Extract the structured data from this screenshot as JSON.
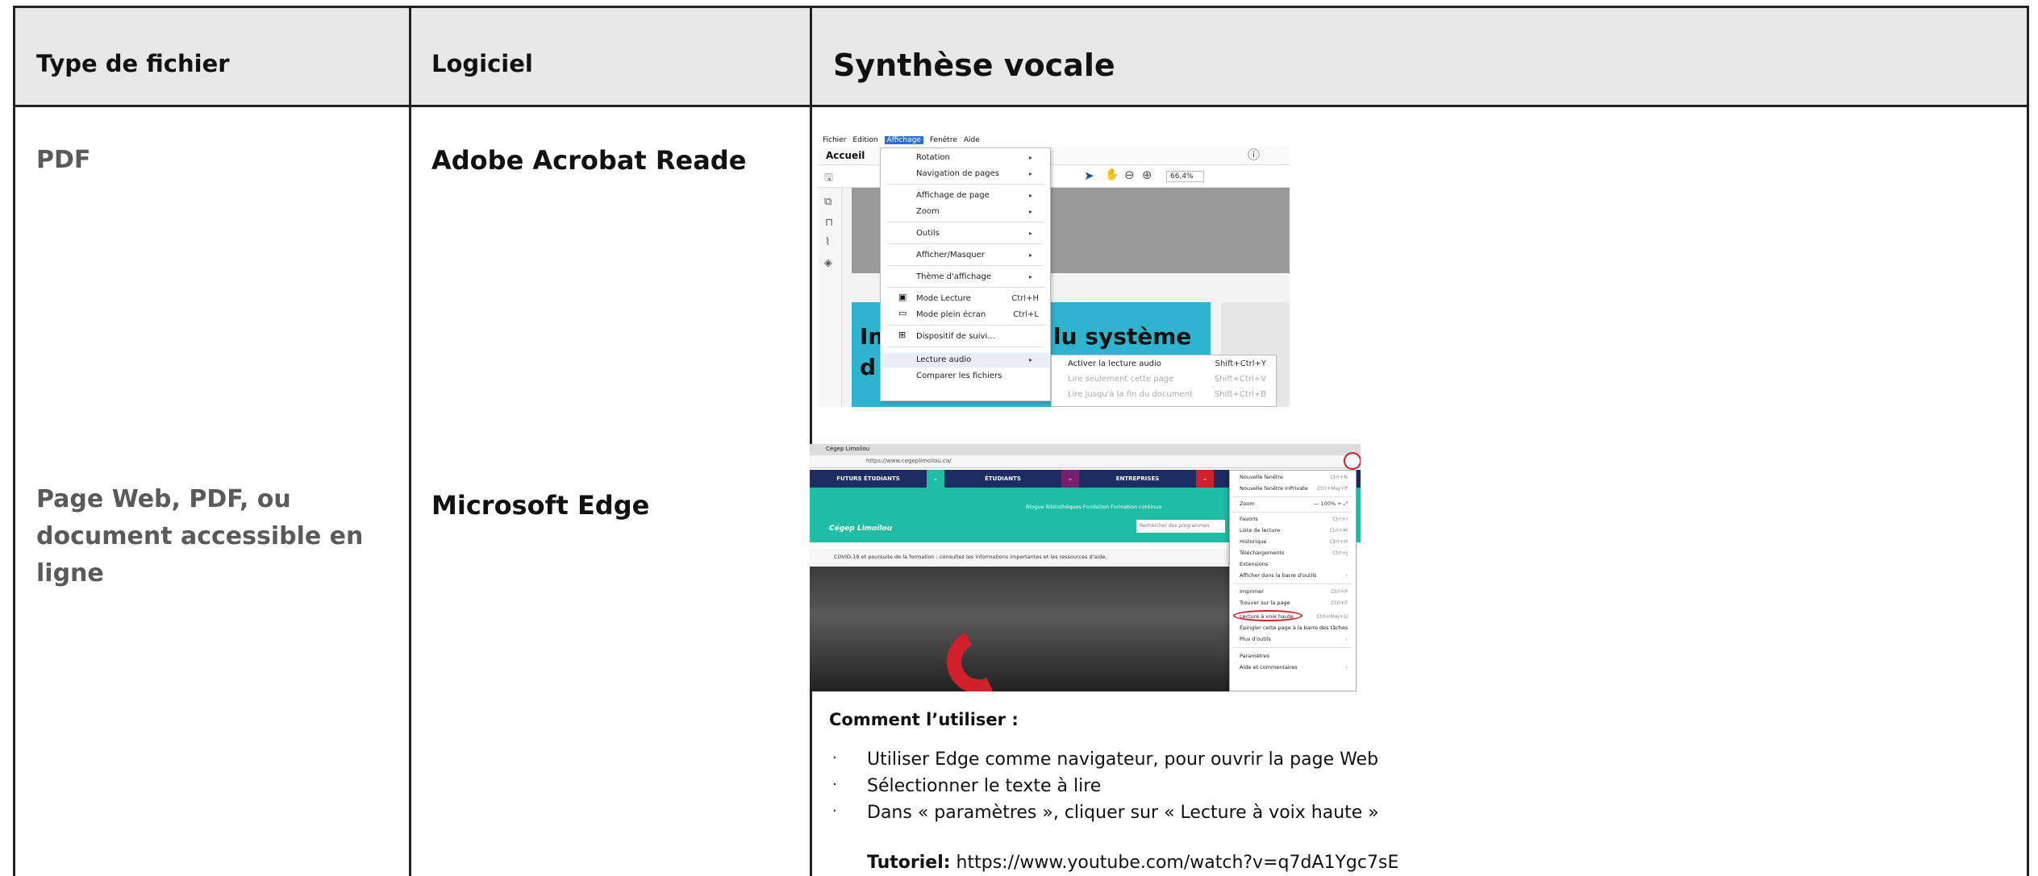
{
  "table": {
    "headers": {
      "type": "Type de fichier",
      "software": "Logiciel",
      "tts": "Synthèse vocale"
    },
    "rows": [
      {
        "type": "PDF",
        "software": "Adobe Acrobat Reade"
      },
      {
        "type_lines": [
          "Page Web, PDF, ou",
          "document accessible en",
          "ligne"
        ],
        "software": "Microsoft Edge"
      }
    ]
  },
  "acrobat_screenshot": {
    "menubar": [
      "Fichier",
      "Edition",
      "Affichage",
      "Fenêtre",
      "Aide"
    ],
    "tab": "Accueil",
    "zoom": "66,4%",
    "menu_items": [
      {
        "label": "Rotation",
        "submenu": true
      },
      {
        "label": "Navigation de pages",
        "submenu": true
      },
      {
        "label": "Affichage de page",
        "submenu": true
      },
      {
        "label": "Zoom",
        "submenu": true
      },
      {
        "label": "Outils",
        "submenu": true
      },
      {
        "label": "Afficher/Masquer",
        "submenu": true
      },
      {
        "label": "Thème d'affichage",
        "submenu": true
      },
      {
        "label": "Mode Lecture",
        "shortcut": "Ctrl+H"
      },
      {
        "label": "Mode plein écran",
        "shortcut": "Ctrl+L"
      },
      {
        "label": "Dispositif de suivi..."
      },
      {
        "label": "Lecture audio",
        "submenu": true,
        "highlighted": true
      },
      {
        "label": "Comparer les fichiers"
      }
    ],
    "submenu_items": [
      {
        "label": "Activer la lecture audio",
        "shortcut": "Shift+Ctrl+Y"
      },
      {
        "label": "Lire seulement cette page",
        "shortcut": "Shift+Ctrl+V"
      },
      {
        "label": "Lire jusqu'à la fin du document",
        "shortcut": "Shift+Ctrl+B"
      }
    ],
    "doc_text_left_1": "Im",
    "doc_text_left_2": "d",
    "doc_text_right": "lu système"
  },
  "edge_screenshot": {
    "tab_title": "Cégep Limoilou",
    "url": "https://www.cegeplimoilou.ca/",
    "nav": [
      "FUTURS ÉTUDIANTS",
      "ÉTUDIANTS",
      "ENTREPRISES"
    ],
    "logo": "Cégep Limoilou",
    "links": "Blogue   Bibliothèques   Fondation   Formation continue",
    "search_placeholder": "Rechercher des programmes",
    "notice": "COVID-19 et poursuite de la formation : consultez les informations importantes et les ressources d'aide.",
    "menu": [
      {
        "label": "Nouvelle fenêtre",
        "shortcut": "Ctrl+N"
      },
      {
        "label": "Nouvelle fenêtre InPrivate",
        "shortcut": "Ctrl+Maj+P"
      },
      {
        "label": "Zoom",
        "shortcut": "—  100%  +  ⤢"
      },
      {
        "label": "Favoris",
        "shortcut": "Ctrl+I"
      },
      {
        "label": "Liste de lecture",
        "shortcut": "Ctrl+M"
      },
      {
        "label": "Historique",
        "shortcut": "Ctrl+H"
      },
      {
        "label": "Téléchargements",
        "shortcut": "Ctrl+J"
      },
      {
        "label": "Extensions",
        "shortcut": ""
      },
      {
        "label": "Afficher dans la barre d'outils",
        "shortcut": "›"
      },
      {
        "label": "Imprimer",
        "shortcut": "Ctrl+P"
      },
      {
        "label": "Trouver sur la page",
        "shortcut": "Ctrl+F"
      },
      {
        "label": "Lecture à voix haute",
        "shortcut": "Ctrl+Maj+U"
      },
      {
        "label": "Épingler cette page à la barre des tâches",
        "shortcut": ""
      },
      {
        "label": "Plus d'outils",
        "shortcut": "›"
      },
      {
        "label": "Paramètres",
        "shortcut": ""
      },
      {
        "label": "Aide et commentaires",
        "shortcut": "›"
      }
    ]
  },
  "instructions": {
    "heading": "Comment l’utiliser :",
    "bullet_char": "·",
    "items": [
      "Utiliser Edge comme navigateur, pour ouvrir la page Web",
      "Sélectionner le texte à lire",
      "Dans « paramètres », cliquer sur « Lecture à voix haute »"
    ],
    "tutorial_label": "Tutoriel:",
    "tutorial_url": "https://www.youtube.com/watch?v=q7dA1Ygc7sE"
  }
}
